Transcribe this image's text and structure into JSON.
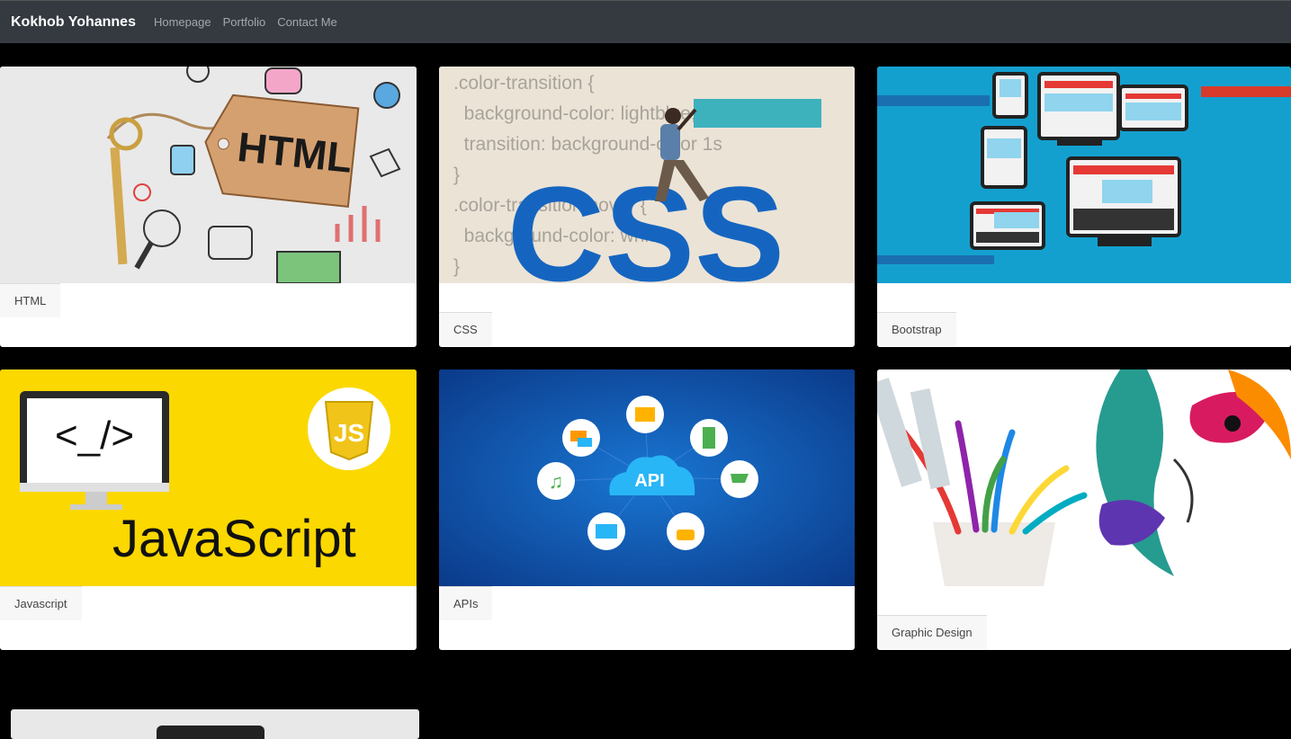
{
  "navbar": {
    "brand": "Kokhob Yohannes",
    "links": [
      "Homepage",
      "Portfolio",
      "Contact Me"
    ]
  },
  "cards": [
    {
      "title": "HTML",
      "image": "html-tag-key-illustration"
    },
    {
      "title": "CSS",
      "image": "css-code-woman-painting"
    },
    {
      "title": "Bootstrap",
      "image": "responsive-devices-illustration"
    },
    {
      "title": "Javascript",
      "image": "javascript-monitor-logo"
    },
    {
      "title": "APIs",
      "image": "api-cloud-icons"
    },
    {
      "title": "Graphic Design",
      "image": "colorful-face-art"
    }
  ],
  "images": {
    "html_tag_text": "HTML",
    "css_code_lines": [
      ".color-transition {",
      "  background-color: lightblue;",
      "  transition: background-color 1s",
      "}",
      ".color-transition:hover {",
      "  background-color: white;",
      "}"
    ],
    "css_logo": "CSS",
    "js_code_glyph": "<_/>",
    "js_word": "JavaScript",
    "js_badge": "JS",
    "api_label": "API"
  }
}
